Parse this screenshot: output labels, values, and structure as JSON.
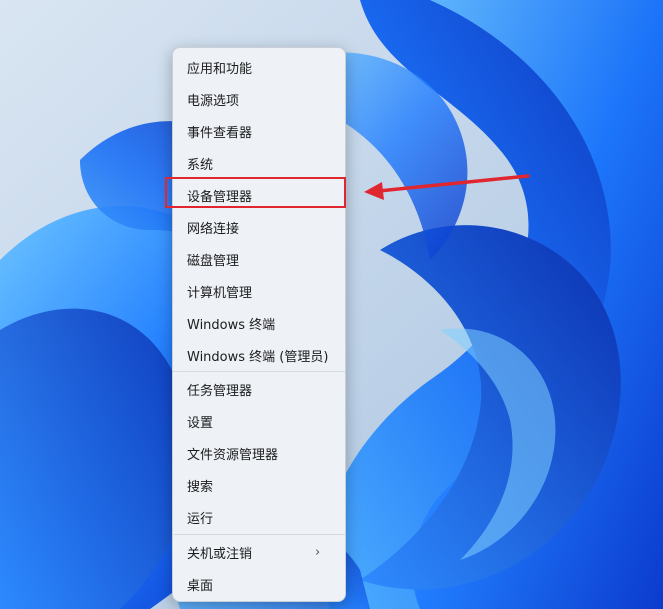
{
  "menu": {
    "items": [
      {
        "label": "应用和功能"
      },
      {
        "label": "电源选项"
      },
      {
        "label": "事件查看器"
      },
      {
        "label": "系统"
      },
      {
        "label": "设备管理器",
        "highlighted": true
      },
      {
        "label": "网络连接"
      },
      {
        "label": "磁盘管理"
      },
      {
        "label": "计算机管理"
      },
      {
        "label": "Windows 终端"
      },
      {
        "label": "Windows 终端 (管理员)"
      },
      {
        "label": "任务管理器"
      },
      {
        "label": "设置"
      },
      {
        "label": "文件资源管理器"
      },
      {
        "label": "搜索"
      },
      {
        "label": "运行"
      },
      {
        "label": "关机或注销",
        "submenu_icon": "chevron-right-icon"
      },
      {
        "label": "桌面"
      }
    ]
  },
  "annotation": {
    "highlight_color": "#e0262e",
    "arrow_icon": "arrow-left-icon"
  },
  "wallpaper": {
    "theme": "windows-11-bloom",
    "colors": [
      "#bcd0e6",
      "#0b3fd1",
      "#1f7fff",
      "#55b8ff"
    ]
  }
}
